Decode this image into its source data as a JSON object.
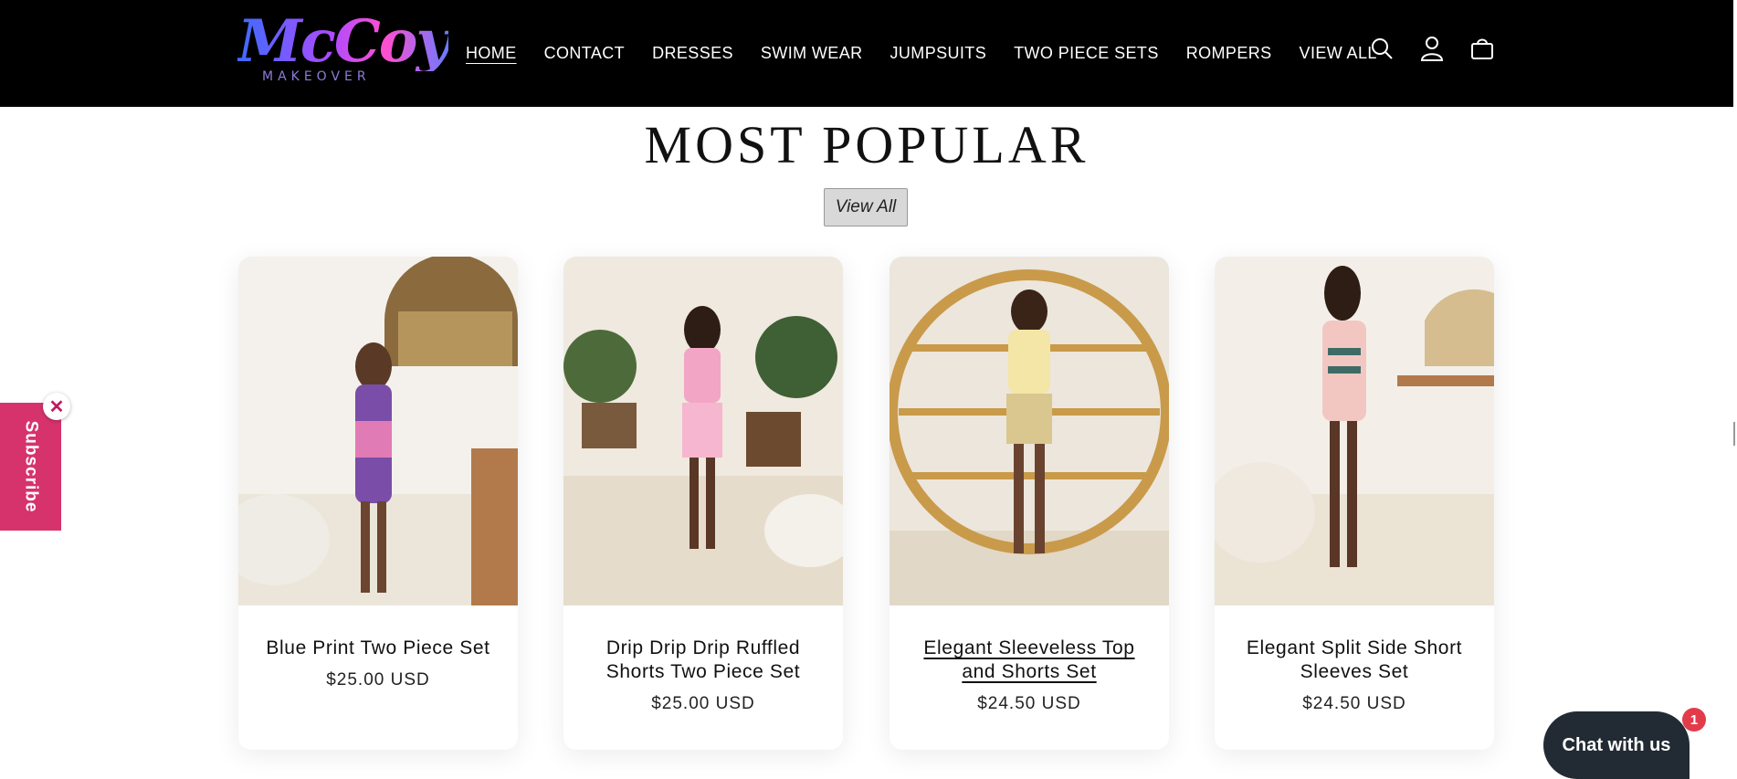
{
  "header": {
    "logo_script": "McCoy",
    "logo_sub": "MAKEOVER",
    "nav": [
      {
        "label": "HOME",
        "active": true
      },
      {
        "label": "CONTACT"
      },
      {
        "label": "DRESSES"
      },
      {
        "label": "SWIM WEAR"
      },
      {
        "label": "JUMPSUITS"
      },
      {
        "label": "TWO PIECE SETS"
      },
      {
        "label": "ROMPERS"
      },
      {
        "label": "VIEW ALL"
      }
    ],
    "icons": [
      "search-icon",
      "account-icon",
      "cart-icon"
    ]
  },
  "section": {
    "title": "MOST POPULAR",
    "view_all": "View All"
  },
  "products": [
    {
      "title": "Blue Print Two Piece Set",
      "price": "$25.00 USD"
    },
    {
      "title": "Drip Drip Drip Ruffled Shorts Two Piece Set",
      "price": "$25.00 USD"
    },
    {
      "title": "Elegant Sleeveless Top and Shorts Set",
      "price": "$24.50 USD"
    },
    {
      "title": "Elegant Split Side Short Sleeves Set",
      "price": "$24.50 USD"
    }
  ],
  "subscribe": {
    "label": "Subscribe",
    "close": "✕"
  },
  "chat": {
    "label": "Chat with us",
    "badge": "1"
  },
  "colors": {
    "header_bg": "#000000",
    "subscribe": "#d6336c",
    "chat_bg": "#222b34",
    "badge": "#e23c4b"
  }
}
